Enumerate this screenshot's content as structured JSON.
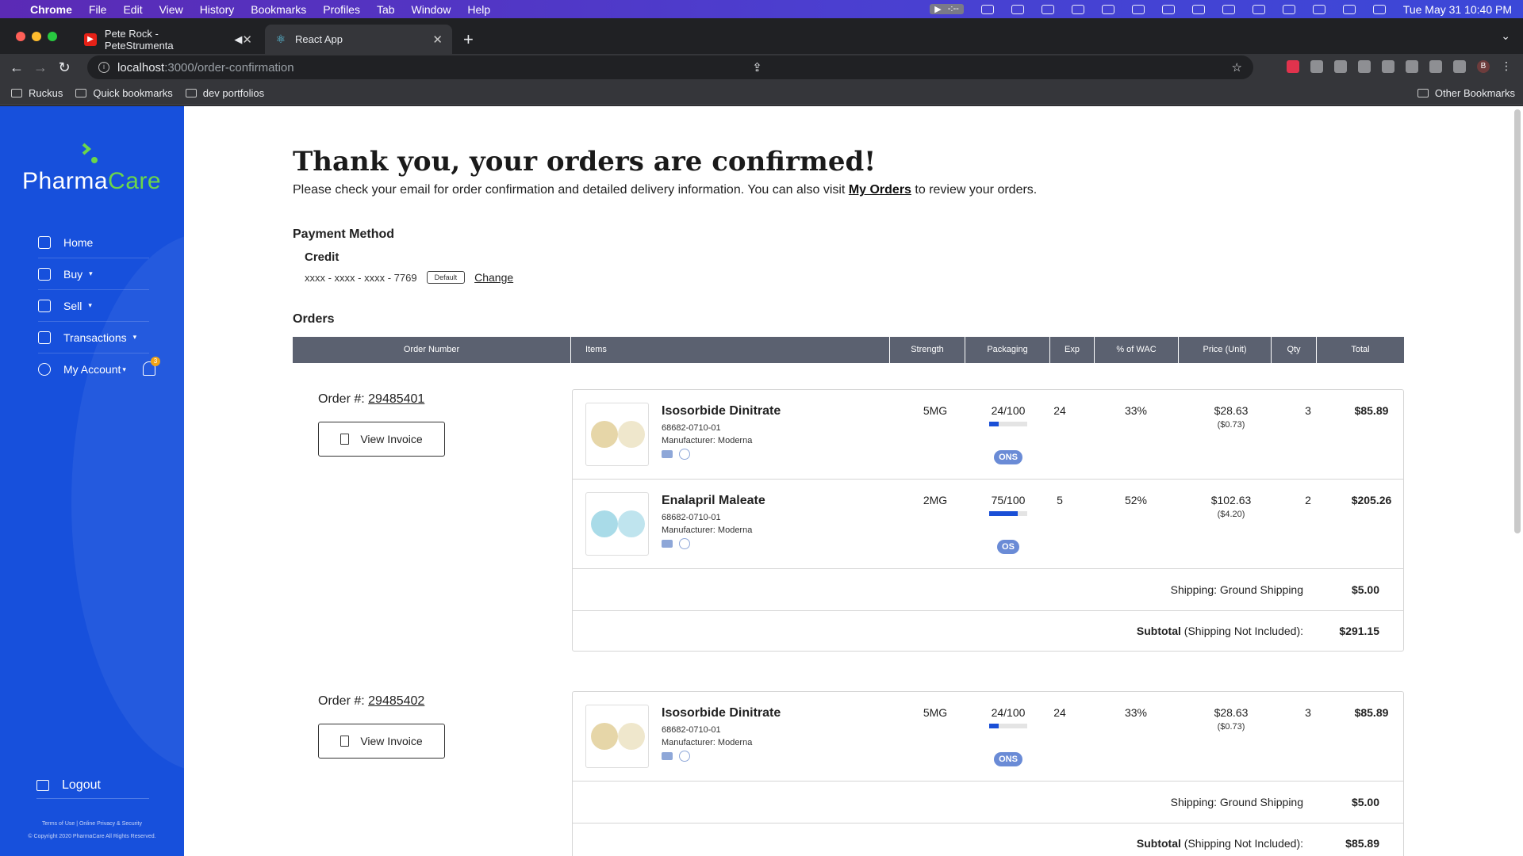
{
  "menubar": {
    "app": "Chrome",
    "items": [
      "File",
      "Edit",
      "View",
      "History",
      "Bookmarks",
      "Profiles",
      "Tab",
      "Window",
      "Help"
    ],
    "media": "-:--",
    "clock": "Tue May 31  10:40 PM"
  },
  "tabs": [
    {
      "title": "Pete Rock - PeteStrumenta",
      "icon": "youtube-icon"
    },
    {
      "title": "React App",
      "icon": "react-icon"
    }
  ],
  "address": {
    "host": "localhost",
    "path": ":3000/order-confirmation"
  },
  "bookmarks": [
    "Ruckus",
    "Quick bookmarks",
    "dev portfolios"
  ],
  "other_bookmarks": "Other Bookmarks",
  "profile_initial": "B",
  "sidebar": {
    "logo_a": "Pharma",
    "logo_b": "Care",
    "nav": [
      {
        "label": "Home",
        "icon": "home-icon"
      },
      {
        "label": "Buy",
        "icon": "bag-icon"
      },
      {
        "label": "Sell",
        "icon": "store-icon"
      },
      {
        "label": "Transactions",
        "icon": "cash-icon"
      },
      {
        "label": "My Account",
        "icon": "user-icon"
      }
    ],
    "notification_count": "3",
    "logout": "Logout",
    "footer_links": "Terms of Use | Online Privacy & Security",
    "copyright": "© Copyright 2020 PharmaCare All Rights Reserved."
  },
  "page": {
    "title": "Thank you, your orders are confirmed!",
    "subtitle_pre": "Please check your email for order confirmation and detailed delivery information. You can also visit ",
    "subtitle_link": "My Orders",
    "subtitle_post": " to review your orders.",
    "payment_heading": "Payment Method",
    "payment_type": "Credit",
    "card_number": "xxxx - xxxx - xxxx - 7769",
    "default_badge": "Default",
    "change_link": "Change",
    "orders_heading": "Orders"
  },
  "table_headers": [
    "Order Number",
    "Items",
    "Strength",
    "Packaging",
    "Exp",
    "% of WAC",
    "Price (Unit)",
    "Qty",
    "Total"
  ],
  "orders": [
    {
      "label": "Order #:",
      "number": "29485401",
      "invoice_label": "View Invoice",
      "items": [
        {
          "name": "Isosorbide Dinitrate",
          "ndc": "68682-0710-01",
          "manufacturer": "Manufacturer: Moderna",
          "strength": "5MG",
          "packaging": "24/100",
          "packaging_fill": 0.24,
          "tag": "ONS",
          "exp": "24",
          "wac": "33%",
          "price": "$28.63",
          "price_unit": "($0.73)",
          "qty": "3",
          "total": "$85.89",
          "pill_color": "#e6d6a8"
        },
        {
          "name": "Enalapril Maleate",
          "ndc": "68682-0710-01",
          "manufacturer": "Manufacturer: Moderna",
          "strength": "2MG",
          "packaging": "75/100",
          "packaging_fill": 0.75,
          "tag": "OS",
          "exp": "5",
          "wac": "52%",
          "price": "$102.63",
          "price_unit": "($4.20)",
          "qty": "2",
          "total": "$205.26",
          "pill_color": "#a9dbe8"
        }
      ],
      "shipping_label": "Shipping:",
      "shipping_method": "Ground Shipping",
      "shipping_cost": "$5.00",
      "subtotal_label": "Subtotal",
      "subtotal_note": "(Shipping Not Included):",
      "subtotal": "$291.15"
    },
    {
      "label": "Order #:",
      "number": "29485402",
      "invoice_label": "View Invoice",
      "items": [
        {
          "name": "Isosorbide Dinitrate",
          "ndc": "68682-0710-01",
          "manufacturer": "Manufacturer: Moderna",
          "strength": "5MG",
          "packaging": "24/100",
          "packaging_fill": 0.24,
          "tag": "ONS",
          "exp": "24",
          "wac": "33%",
          "price": "$28.63",
          "price_unit": "($0.73)",
          "qty": "3",
          "total": "$85.89",
          "pill_color": "#e6d6a8"
        }
      ],
      "shipping_label": "Shipping:",
      "shipping_method": "Ground Shipping",
      "shipping_cost": "$5.00",
      "subtotal_label": "Subtotal",
      "subtotal_note": "(Shipping Not Included):",
      "subtotal": "$85.89"
    }
  ]
}
